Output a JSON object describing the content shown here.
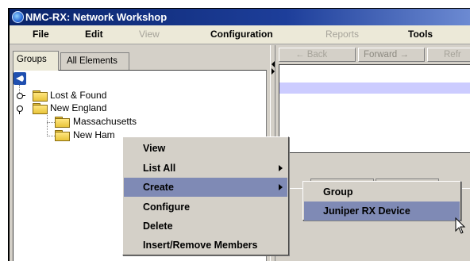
{
  "window": {
    "title": "NMC-RX: Network Workshop"
  },
  "menubar": {
    "items": [
      {
        "label": "File",
        "enabled": true
      },
      {
        "label": "Edit",
        "enabled": true
      },
      {
        "label": "View",
        "enabled": false
      },
      {
        "label": "Configuration",
        "enabled": true
      },
      {
        "label": "Reports",
        "enabled": false
      },
      {
        "label": "Tools",
        "enabled": true
      }
    ]
  },
  "tabs": [
    {
      "label": "Groups",
      "active": true
    },
    {
      "label": "All Elements",
      "active": false
    }
  ],
  "tree": {
    "nodes": [
      {
        "label": "Lost & Found",
        "expanded": false
      },
      {
        "label": "New England",
        "expanded": true
      },
      {
        "label": "Massachusetts"
      },
      {
        "label": "New Ham"
      }
    ]
  },
  "nav": {
    "back_label": "← Back",
    "forward_label": "Forward →",
    "refresh_label": "Refr"
  },
  "context_menu": {
    "items": [
      {
        "label": "View",
        "has_submenu": false
      },
      {
        "label": "List All",
        "has_submenu": true
      },
      {
        "label": "Create",
        "has_submenu": true,
        "selected": true
      },
      {
        "label": "Configure",
        "has_submenu": false
      },
      {
        "label": "Delete",
        "has_submenu": false
      },
      {
        "label": "Insert/Remove Members",
        "has_submenu": false
      }
    ]
  },
  "submenu": {
    "items": [
      {
        "label": "Group",
        "selected": false
      },
      {
        "label": "Juniper RX Device",
        "selected": true
      }
    ]
  },
  "colors": {
    "title_bar": "#0a246a",
    "selection": "#7f8ab5",
    "browser_band": "#ccccff",
    "folder": "#e8c43a"
  }
}
